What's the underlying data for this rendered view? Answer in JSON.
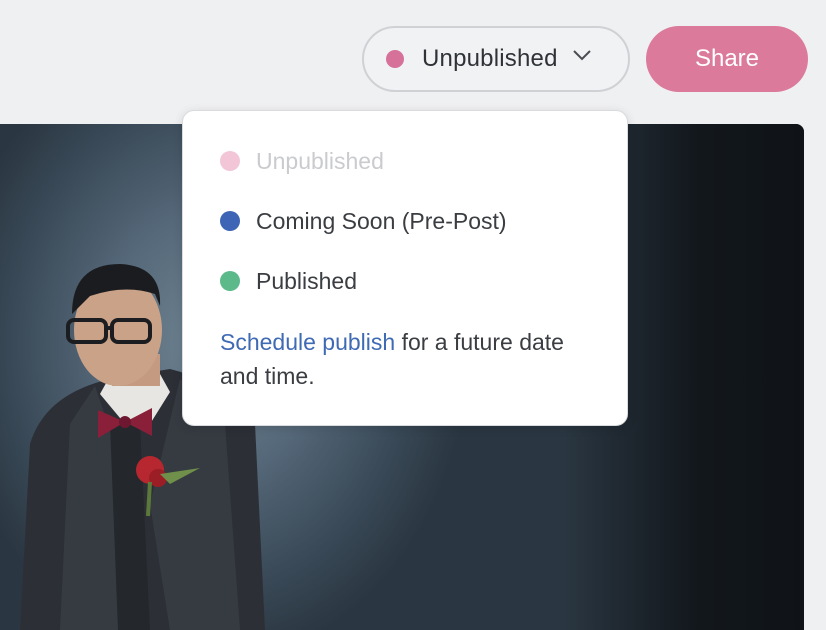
{
  "status_select": {
    "current_label": "Unpublished",
    "dot_color": "#d6719a",
    "chevron_icon": "chevron-down-icon"
  },
  "share": {
    "label": "Share",
    "color": "#dc7a9c"
  },
  "menu": {
    "items": [
      {
        "label": "Unpublished",
        "dot_color": "#f2c6d6",
        "disabled": true
      },
      {
        "label": "Coming Soon (Pre-Post)",
        "dot_color": "#3e65b5",
        "disabled": false
      },
      {
        "label": "Published",
        "dot_color": "#5bb98a",
        "disabled": false
      }
    ],
    "schedule_link": "Schedule publish",
    "schedule_text": " for a future date and time."
  },
  "photo": {
    "subject": "photo-groom"
  }
}
